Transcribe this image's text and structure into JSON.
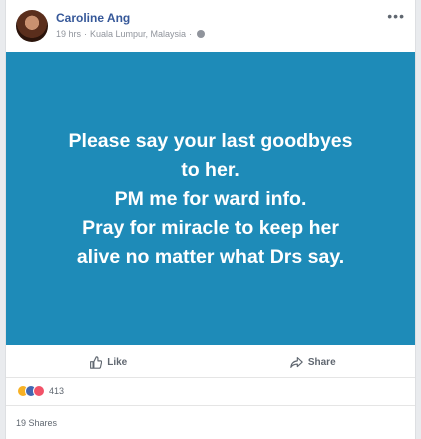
{
  "post": {
    "author": "Caroline Ang",
    "time": "19 hrs",
    "separator": "·",
    "location": "Kuala Lumpur, Malaysia",
    "more": "•••",
    "image_lines": [
      "Please say your last goodbyes",
      "to her.",
      "PM me for ward info.",
      "Pray for miracle to keep her",
      "alive no matter what Drs say."
    ]
  },
  "actions": {
    "like_label": "Like",
    "share_label": "Share"
  },
  "stats": {
    "reaction_count": "413",
    "shares": "19 Shares"
  },
  "colors": {
    "image_bg": "#1e8bb8",
    "link": "#365899",
    "muted": "#90949c"
  },
  "icons": {
    "reactions": [
      "sad-reaction-icon",
      "like-reaction-icon",
      "love-reaction-icon"
    ]
  }
}
